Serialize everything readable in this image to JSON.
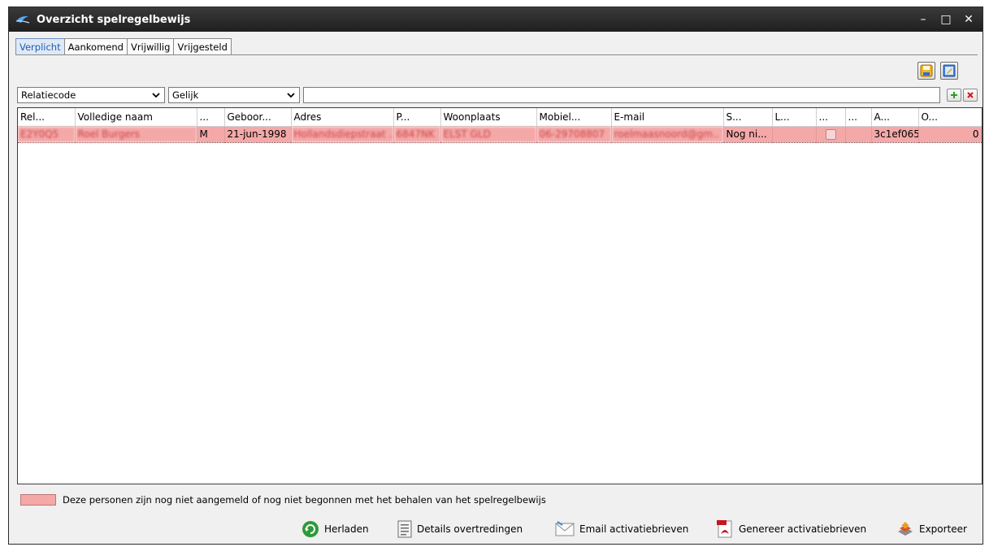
{
  "window": {
    "title": "Overzicht spelregelbewijs",
    "controls": {
      "minimize": "–",
      "maximize": "□",
      "close": "✕"
    }
  },
  "tabs": [
    {
      "label": "Verplicht",
      "active": true
    },
    {
      "label": "Aankomend",
      "active": false
    },
    {
      "label": "Vrijwillig",
      "active": false
    },
    {
      "label": "Vrijgesteld",
      "active": false
    }
  ],
  "toolbar": {
    "icons": [
      "save-layout-icon",
      "edit-layout-icon"
    ]
  },
  "filter": {
    "field": "Relatiecode",
    "operator": "Gelijk",
    "value": "",
    "add_icon": "plus-icon",
    "remove_icon": "x-icon"
  },
  "grid": {
    "columns": [
      "Rel...",
      "Volledige naam",
      "...",
      "Geboor...",
      "Adres",
      "P...",
      "Woonplaats",
      "Mobiel...",
      "E-mail",
      "S...",
      "L...",
      "...",
      "...",
      "A...",
      "O..."
    ],
    "rows": [
      {
        "relatiecode": "E2Y0Q5",
        "naam": "Roel Burgers",
        "geslacht": "M",
        "geboortedatum": "21-jun-1998",
        "adres": "Hollandsdiepstraat ..",
        "postcode": "6847NK",
        "woonplaats": "ELST GLD",
        "mobiel": "06-29708807",
        "email": "roelmaasnoord@gm..",
        "status": "Nog ni...",
        "l": "",
        "checked": false,
        "extra": "",
        "a": "3c1ef065",
        "o": "0"
      }
    ]
  },
  "legend": {
    "color": "#f4a8a8",
    "text": "Deze personen zijn nog niet aangemeld of nog niet begonnen met het behalen van het spelregelbewijs"
  },
  "actions": [
    {
      "label": "Herladen",
      "icon": "reload-icon"
    },
    {
      "label": "Details overtredingen",
      "icon": "document-icon"
    },
    {
      "label": "Email activatiebrieven",
      "icon": "envelope-icon"
    },
    {
      "label": "Genereer activatiebrieven",
      "icon": "pdf-icon"
    },
    {
      "label": "Exporteer",
      "icon": "export-icon"
    }
  ]
}
